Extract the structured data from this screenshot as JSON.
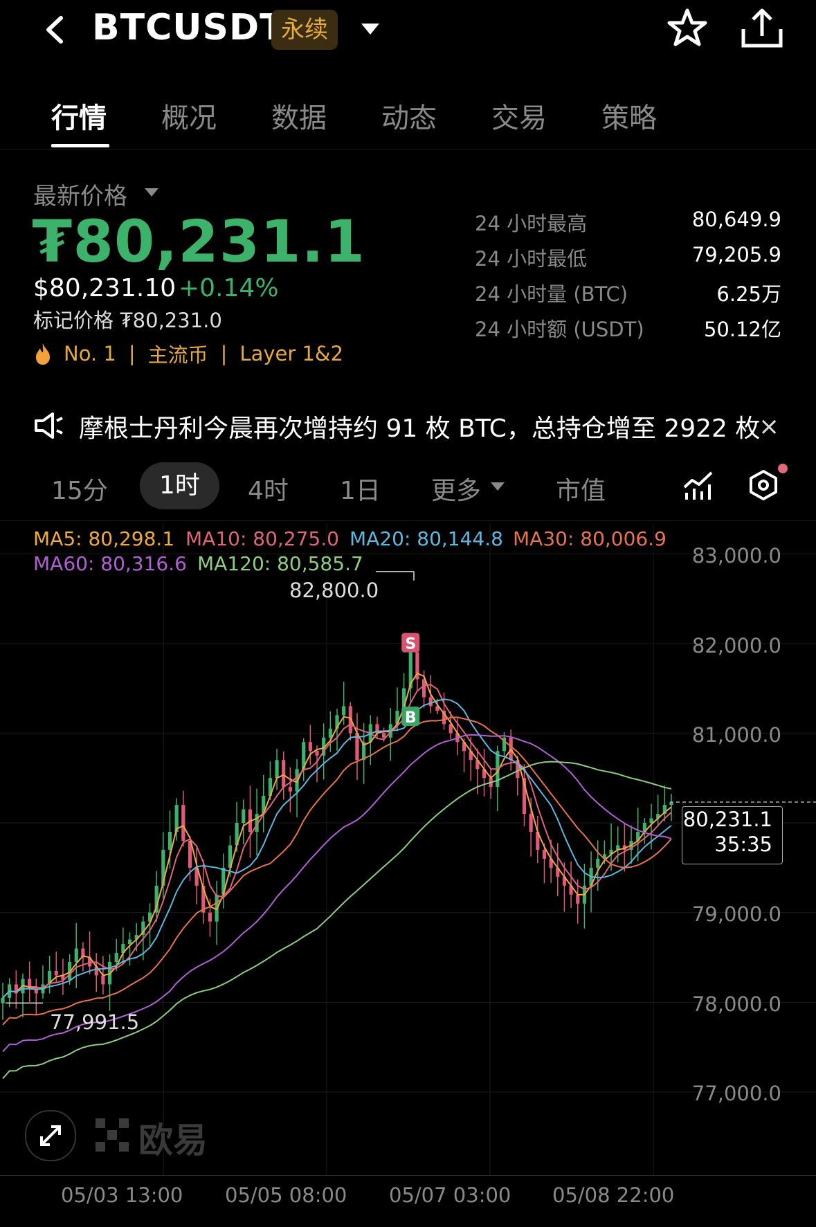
{
  "header": {
    "symbol": "BTCUSDT",
    "badge": "永续",
    "icons": [
      "back-chevron-icon",
      "dropdown-caret-icon",
      "star-icon",
      "share-icon"
    ]
  },
  "tabs": [
    {
      "label": "行情",
      "active": true
    },
    {
      "label": "概况",
      "active": false
    },
    {
      "label": "数据",
      "active": false
    },
    {
      "label": "动态",
      "active": false
    },
    {
      "label": "交易",
      "active": false
    },
    {
      "label": "策略",
      "active": false
    }
  ],
  "price": {
    "label": "最新价格",
    "last": "₮80,231.1",
    "usd": "$80,231.10",
    "change": "+0.14%",
    "mark_label": "标记价格",
    "mark_value": "₮80,231.0",
    "tags": [
      "No. 1",
      "主流币",
      "Layer 1&2"
    ],
    "stats": [
      {
        "label": "24 小时最高",
        "value": "80,649.9"
      },
      {
        "label": "24 小时最低",
        "value": "79,205.9"
      },
      {
        "label": "24 小时量 (BTC)",
        "value": "6.25万"
      },
      {
        "label": "24 小时额 (USDT)",
        "value": "50.12亿"
      }
    ]
  },
  "news": {
    "text": "摩根士丹利今晨再次增持约 91 枚 BTC，总持仓增至 2922 枚",
    "close": "×"
  },
  "intervals": {
    "items": [
      "15分",
      "1时",
      "4时",
      "1日"
    ],
    "active": "1时",
    "more": "更多",
    "market_cap": "市值"
  },
  "ma_legend": [
    {
      "label": "MA5: 80,298.1",
      "color": "#f0a93e"
    },
    {
      "label": "MA10: 80,275.0",
      "color": "#e0647a"
    },
    {
      "label": "MA20: 80,144.8",
      "color": "#5cb8e0"
    },
    {
      "label": "MA30: 80,006.9",
      "color": "#e8734a"
    },
    {
      "label": "MA60: 80,316.6",
      "color": "#b25fd6"
    },
    {
      "label": "MA120: 80,585.7",
      "color": "#8ccf7e"
    }
  ],
  "colors": {
    "up": "#3db26b",
    "down": "#e05a78",
    "accent": "#e7a93b"
  },
  "chart_data": {
    "type": "candlestick",
    "y_ticks": [
      "83,000.0",
      "82,000.0",
      "81,000.0",
      "79,000.0",
      "78,000.0",
      "77,000.0"
    ],
    "ylim": [
      76200,
      83300
    ],
    "x_ticks": [
      "05/03 13:00",
      "05/05 08:00",
      "05/07 03:00",
      "05/08 22:00"
    ],
    "high_label": "82,800.0",
    "low_label": "77,991.5",
    "current_price": "80,231.1",
    "countdown": "35:35",
    "markers": [
      {
        "label": "S",
        "price": 82000,
        "index": 61
      },
      {
        "label": "B",
        "price": 81180,
        "index": 61
      }
    ],
    "closes": [
      78050,
      78200,
      78100,
      78260,
      78150,
      78100,
      78200,
      78350,
      78300,
      78250,
      78450,
      78600,
      78500,
      78400,
      78300,
      78200,
      78450,
      78550,
      78650,
      78700,
      78750,
      78900,
      79000,
      79300,
      79700,
      79900,
      80200,
      79800,
      79500,
      79300,
      79000,
      78900,
      79200,
      79500,
      79750,
      80000,
      80150,
      79900,
      80100,
      80300,
      80500,
      80700,
      80400,
      80350,
      80600,
      80900,
      80800,
      80750,
      80950,
      81050,
      81200,
      81300,
      81000,
      80700,
      80900,
      81100,
      81000,
      80950,
      81100,
      81250,
      81500,
      81900,
      81600,
      81400,
      81300,
      81250,
      81100,
      81000,
      80900,
      80800,
      80700,
      80600,
      80500,
      80400,
      80800,
      80950,
      80700,
      80500,
      80100,
      79900,
      79700,
      79600,
      79500,
      79400,
      79300,
      79200,
      79100,
      79300,
      79500,
      79600,
      79650,
      79700,
      79750,
      79700,
      79800,
      79900,
      80000,
      80050,
      80100,
      80200,
      80231
    ]
  }
}
